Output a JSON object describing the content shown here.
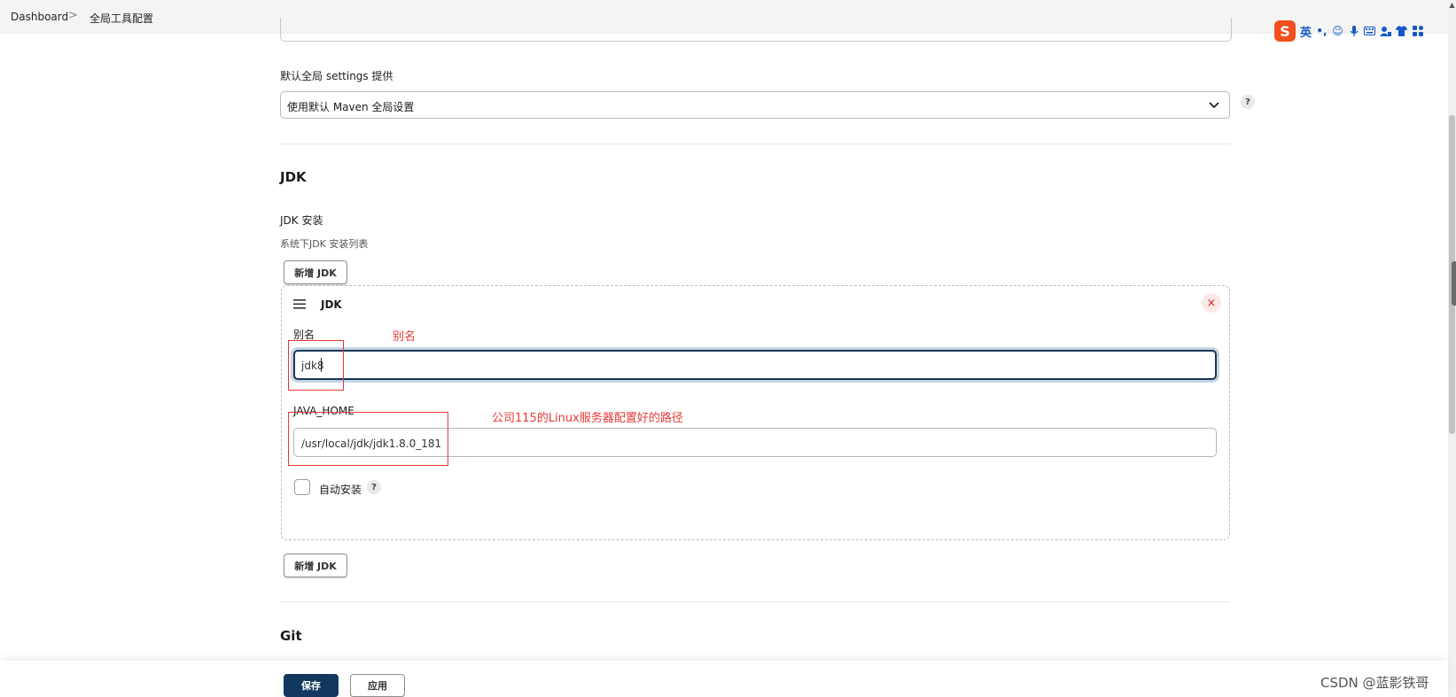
{
  "breadcrumb": {
    "home": "Dashboard",
    "separator": ">",
    "current": "全局工具配置"
  },
  "ime_toolbar": {
    "logo": "S",
    "mode": "英",
    "icons": [
      "punctuation-icon",
      "emoji-icon",
      "microphone-icon",
      "keyboard-icon",
      "user-icon",
      "skin-icon",
      "grid-icon"
    ]
  },
  "maven": {
    "settings_label": "默认全局 settings 提供",
    "settings_value": "使用默认 Maven 全局设置",
    "help": "?"
  },
  "jdk_section": {
    "title": "JDK",
    "install_label": "JDK 安装",
    "install_desc": "系统下JDK 安装列表",
    "add_button": "新增 JDK",
    "item": {
      "header": "JDK",
      "close": "×",
      "alias_label": "别名",
      "alias_value": "jdk8",
      "java_home_label": "JAVA_HOME",
      "java_home_value": "/usr/local/jdk/jdk1.8.0_181",
      "auto_install_label": "自动安装",
      "help": "?"
    },
    "add_button_bottom": "新增 JDK"
  },
  "annotations": {
    "alias_note": "别名",
    "java_home_note": "公司115的Linux服务器配置好的路径",
    "color": "#e53935"
  },
  "git_section": {
    "title": "Git"
  },
  "footer": {
    "save": "保存",
    "apply": "应用"
  },
  "watermark": "CSDN @蓝影铁哥",
  "colors": {
    "primary": "#12385f",
    "focus_ring": "#c4d4e4"
  }
}
